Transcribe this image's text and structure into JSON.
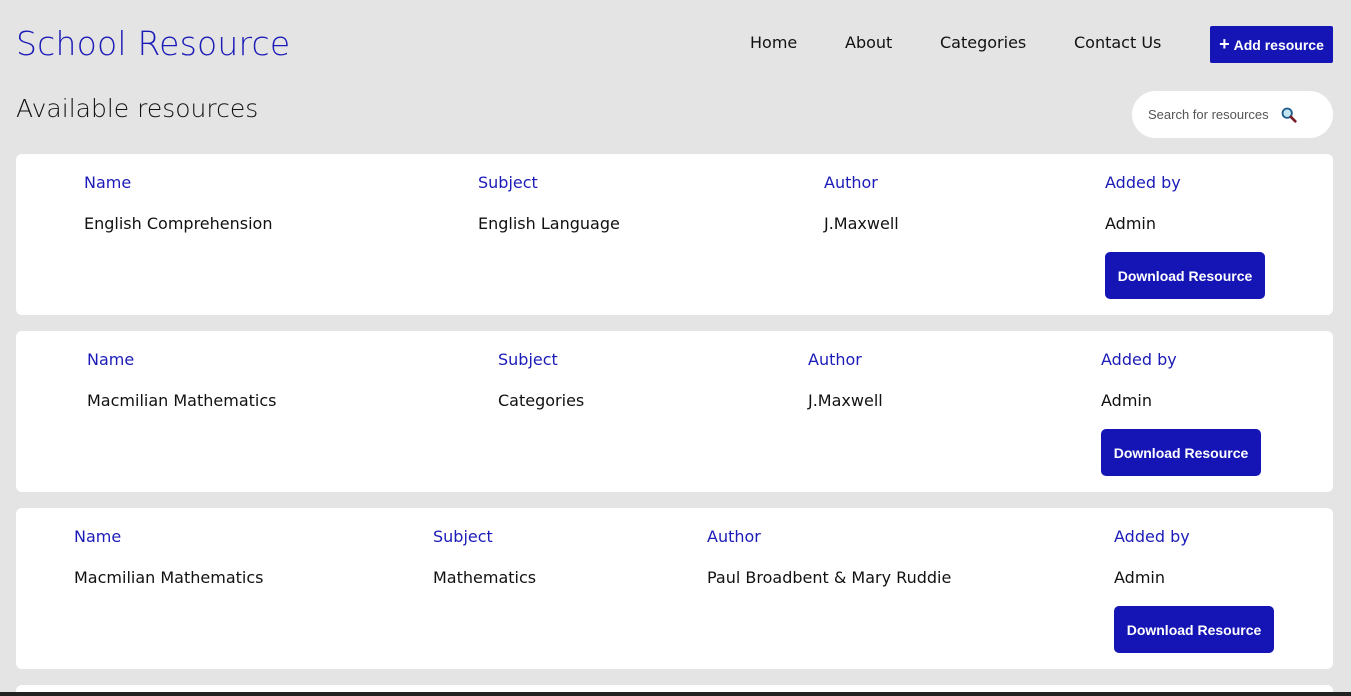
{
  "header": {
    "brand": "School Resource",
    "nav": [
      "Home",
      "About",
      "Categories",
      "Contact Us"
    ],
    "add_button": {
      "icon": "plus-icon",
      "label": "Add resource"
    }
  },
  "main": {
    "title": "Available resources",
    "search": {
      "placeholder": "Search for resources",
      "icon": "magnifier-icon"
    }
  },
  "resources": [
    {
      "labels": {
        "name": "Name",
        "subject": "Subject",
        "author": "Author",
        "added_by": "Added by"
      },
      "name": "English Comprehension",
      "subject": "English Language",
      "author": "J.Maxwell",
      "added_by": "Admin",
      "button": "Download Resource"
    },
    {
      "labels": {
        "name": "Name",
        "subject": "Subject",
        "author": "Author",
        "added_by": "Added by"
      },
      "name": "Macmilian Mathematics",
      "subject": "Categories",
      "author": "J.Maxwell",
      "added_by": "Admin",
      "button": "Download Resource"
    },
    {
      "labels": {
        "name": "Name",
        "subject": "Subject",
        "author": "Author",
        "added_by": "Added by"
      },
      "name": "Macmilian Mathematics",
      "subject": "Mathematics",
      "author": "Paul Broadbent & Mary Ruddie",
      "added_by": "Admin",
      "button": "Download Resource"
    }
  ],
  "colors": {
    "accent": "#1515b5",
    "background": "#e4e4e4",
    "card": "#ffffff"
  }
}
